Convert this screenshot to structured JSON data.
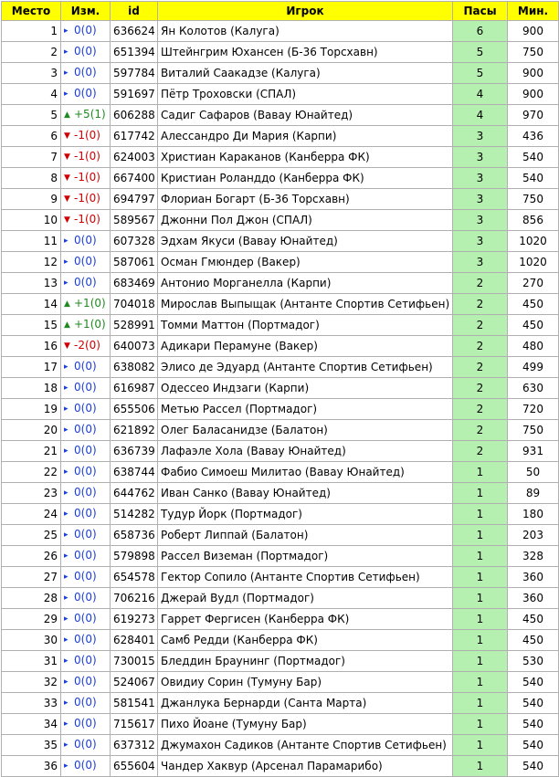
{
  "headers": {
    "rank": "Место",
    "change": "Изм.",
    "id": "id",
    "player": "Игрок",
    "assists": "Пасы",
    "minutes": "Мин."
  },
  "colors": {
    "header_bg": "#ffff00",
    "assists_bg": "#b6f0b0",
    "same": "#1a3fd6",
    "up": "#1f8a1f",
    "down": "#d00000"
  },
  "rows": [
    {
      "rank": "1",
      "dir": "same",
      "change": "0(0)",
      "id": "636624",
      "player": "Ян Колотов (Калуга)",
      "assists": "6",
      "minutes": "900"
    },
    {
      "rank": "2",
      "dir": "same",
      "change": "0(0)",
      "id": "651394",
      "player": "Штейнгрим Юхансен (Б-36 Торсхавн)",
      "assists": "5",
      "minutes": "750"
    },
    {
      "rank": "3",
      "dir": "same",
      "change": "0(0)",
      "id": "597784",
      "player": "Виталий Саакадзе (Калуга)",
      "assists": "5",
      "minutes": "900"
    },
    {
      "rank": "4",
      "dir": "same",
      "change": "0(0)",
      "id": "591697",
      "player": "Пётр Троховски (СПАЛ)",
      "assists": "4",
      "minutes": "900"
    },
    {
      "rank": "5",
      "dir": "up",
      "change": "+5(1)",
      "id": "606288",
      "player": "Садиг Сафаров (Вавау Юнайтед)",
      "assists": "4",
      "minutes": "970"
    },
    {
      "rank": "6",
      "dir": "down",
      "change": "-1(0)",
      "id": "617742",
      "player": "Алессандро Ди Мария (Карпи)",
      "assists": "3",
      "minutes": "436"
    },
    {
      "rank": "7",
      "dir": "down",
      "change": "-1(0)",
      "id": "624003",
      "player": "Христиан Караканов (Канберра ФК)",
      "assists": "3",
      "minutes": "540"
    },
    {
      "rank": "8",
      "dir": "down",
      "change": "-1(0)",
      "id": "667400",
      "player": "Кристиан Роланддо (Канберра ФК)",
      "assists": "3",
      "minutes": "540"
    },
    {
      "rank": "9",
      "dir": "down",
      "change": "-1(0)",
      "id": "694797",
      "player": "Флориан Богарт (Б-36 Торсхавн)",
      "assists": "3",
      "minutes": "750"
    },
    {
      "rank": "10",
      "dir": "down",
      "change": "-1(0)",
      "id": "589567",
      "player": "Джонни Пол Джон (СПАЛ)",
      "assists": "3",
      "minutes": "856"
    },
    {
      "rank": "11",
      "dir": "same",
      "change": "0(0)",
      "id": "607328",
      "player": "Эдхам Якуси (Вавау Юнайтед)",
      "assists": "3",
      "minutes": "1020"
    },
    {
      "rank": "12",
      "dir": "same",
      "change": "0(0)",
      "id": "587061",
      "player": "Осман Гмюндер (Вакер)",
      "assists": "3",
      "minutes": "1020"
    },
    {
      "rank": "13",
      "dir": "same",
      "change": "0(0)",
      "id": "683469",
      "player": "Антонио Морганелла (Карпи)",
      "assists": "2",
      "minutes": "270"
    },
    {
      "rank": "14",
      "dir": "up",
      "change": "+1(0)",
      "id": "704018",
      "player": "Мирослав Выпыщак (Антанте Спортив Сетифьен)",
      "assists": "2",
      "minutes": "450"
    },
    {
      "rank": "15",
      "dir": "up",
      "change": "+1(0)",
      "id": "528991",
      "player": "Томми Маттон (Портмадог)",
      "assists": "2",
      "minutes": "450"
    },
    {
      "rank": "16",
      "dir": "down",
      "change": "-2(0)",
      "id": "640073",
      "player": "Адикари Перамуне (Вакер)",
      "assists": "2",
      "minutes": "480"
    },
    {
      "rank": "17",
      "dir": "same",
      "change": "0(0)",
      "id": "638082",
      "player": "Элисо де Эдуард (Антанте Спортив Сетифьен)",
      "assists": "2",
      "minutes": "499"
    },
    {
      "rank": "18",
      "dir": "same",
      "change": "0(0)",
      "id": "616987",
      "player": "Одессео Индзаги (Карпи)",
      "assists": "2",
      "minutes": "630"
    },
    {
      "rank": "19",
      "dir": "same",
      "change": "0(0)",
      "id": "655506",
      "player": "Метью Рассел (Портмадог)",
      "assists": "2",
      "minutes": "720"
    },
    {
      "rank": "20",
      "dir": "same",
      "change": "0(0)",
      "id": "621892",
      "player": "Олег Баласанидзе (Балатон)",
      "assists": "2",
      "minutes": "750"
    },
    {
      "rank": "21",
      "dir": "same",
      "change": "0(0)",
      "id": "636739",
      "player": "Лафаэле Хола (Вавау Юнайтед)",
      "assists": "2",
      "minutes": "931"
    },
    {
      "rank": "22",
      "dir": "same",
      "change": "0(0)",
      "id": "638744",
      "player": "Фабио Симоеш Милитао (Вавау Юнайтед)",
      "assists": "1",
      "minutes": "50"
    },
    {
      "rank": "23",
      "dir": "same",
      "change": "0(0)",
      "id": "644762",
      "player": "Иван Санко (Вавау Юнайтед)",
      "assists": "1",
      "minutes": "89"
    },
    {
      "rank": "24",
      "dir": "same",
      "change": "0(0)",
      "id": "514282",
      "player": "Тудур Йорк (Портмадог)",
      "assists": "1",
      "minutes": "180"
    },
    {
      "rank": "25",
      "dir": "same",
      "change": "0(0)",
      "id": "658736",
      "player": "Роберт Липпай (Балатон)",
      "assists": "1",
      "minutes": "203"
    },
    {
      "rank": "26",
      "dir": "same",
      "change": "0(0)",
      "id": "579898",
      "player": "Рассел Виземан (Портмадог)",
      "assists": "1",
      "minutes": "328"
    },
    {
      "rank": "27",
      "dir": "same",
      "change": "0(0)",
      "id": "654578",
      "player": "Гектор Сопило (Антанте Спортив Сетифьен)",
      "assists": "1",
      "minutes": "360"
    },
    {
      "rank": "28",
      "dir": "same",
      "change": "0(0)",
      "id": "706216",
      "player": "Джерай Вудл (Портмадог)",
      "assists": "1",
      "minutes": "360"
    },
    {
      "rank": "29",
      "dir": "same",
      "change": "0(0)",
      "id": "619273",
      "player": "Гаррет Фергисен (Канберра ФК)",
      "assists": "1",
      "minutes": "450"
    },
    {
      "rank": "30",
      "dir": "same",
      "change": "0(0)",
      "id": "628401",
      "player": "Самб Редди (Канберра ФК)",
      "assists": "1",
      "minutes": "450"
    },
    {
      "rank": "31",
      "dir": "same",
      "change": "0(0)",
      "id": "730015",
      "player": "Бледдин Браунинг (Портмадог)",
      "assists": "1",
      "minutes": "530"
    },
    {
      "rank": "32",
      "dir": "same",
      "change": "0(0)",
      "id": "524067",
      "player": "Овидиу Сорин (Тумуну Бар)",
      "assists": "1",
      "minutes": "540"
    },
    {
      "rank": "33",
      "dir": "same",
      "change": "0(0)",
      "id": "581541",
      "player": "Джанлука Бернарди (Санта Марта)",
      "assists": "1",
      "minutes": "540"
    },
    {
      "rank": "34",
      "dir": "same",
      "change": "0(0)",
      "id": "715617",
      "player": "Пихо Йоане (Тумуну Бар)",
      "assists": "1",
      "minutes": "540"
    },
    {
      "rank": "35",
      "dir": "same",
      "change": "0(0)",
      "id": "637312",
      "player": "Джумахон Садиков (Антанте Спортив Сетифьен)",
      "assists": "1",
      "minutes": "540"
    },
    {
      "rank": "36",
      "dir": "same",
      "change": "0(0)",
      "id": "655604",
      "player": "Чандер Хаквур (Арсенал Парамарибо)",
      "assists": "1",
      "minutes": "540"
    }
  ]
}
